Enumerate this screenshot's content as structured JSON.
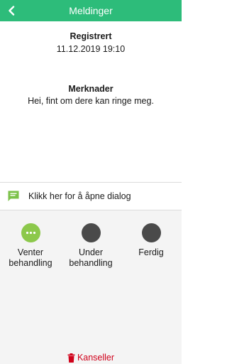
{
  "header": {
    "title": "Meldinger"
  },
  "registered": {
    "label": "Registrert",
    "value": "11.12.2019 19:10"
  },
  "notes": {
    "label": "Merknader",
    "value": "Hei, fint om dere kan ringe meg."
  },
  "dialog": {
    "label": "Klikk her for å åpne dialog"
  },
  "statuses": [
    {
      "line1": "Venter",
      "line2": "behandling",
      "active": true
    },
    {
      "line1": "Under",
      "line2": "behandling",
      "active": false
    },
    {
      "line1": "Ferdig",
      "line2": "",
      "active": false
    }
  ],
  "cancel": {
    "label": "Kanseller"
  },
  "colors": {
    "brand": "#2dbc7a",
    "active_status": "#8cc84b",
    "inactive_status": "#4a4a4a",
    "danger": "#d0021b"
  },
  "icons": {
    "back": "chevron-left-icon",
    "dialog": "chat-bubble-icon",
    "pending": "ellipsis-icon",
    "cancel": "trash-icon"
  }
}
